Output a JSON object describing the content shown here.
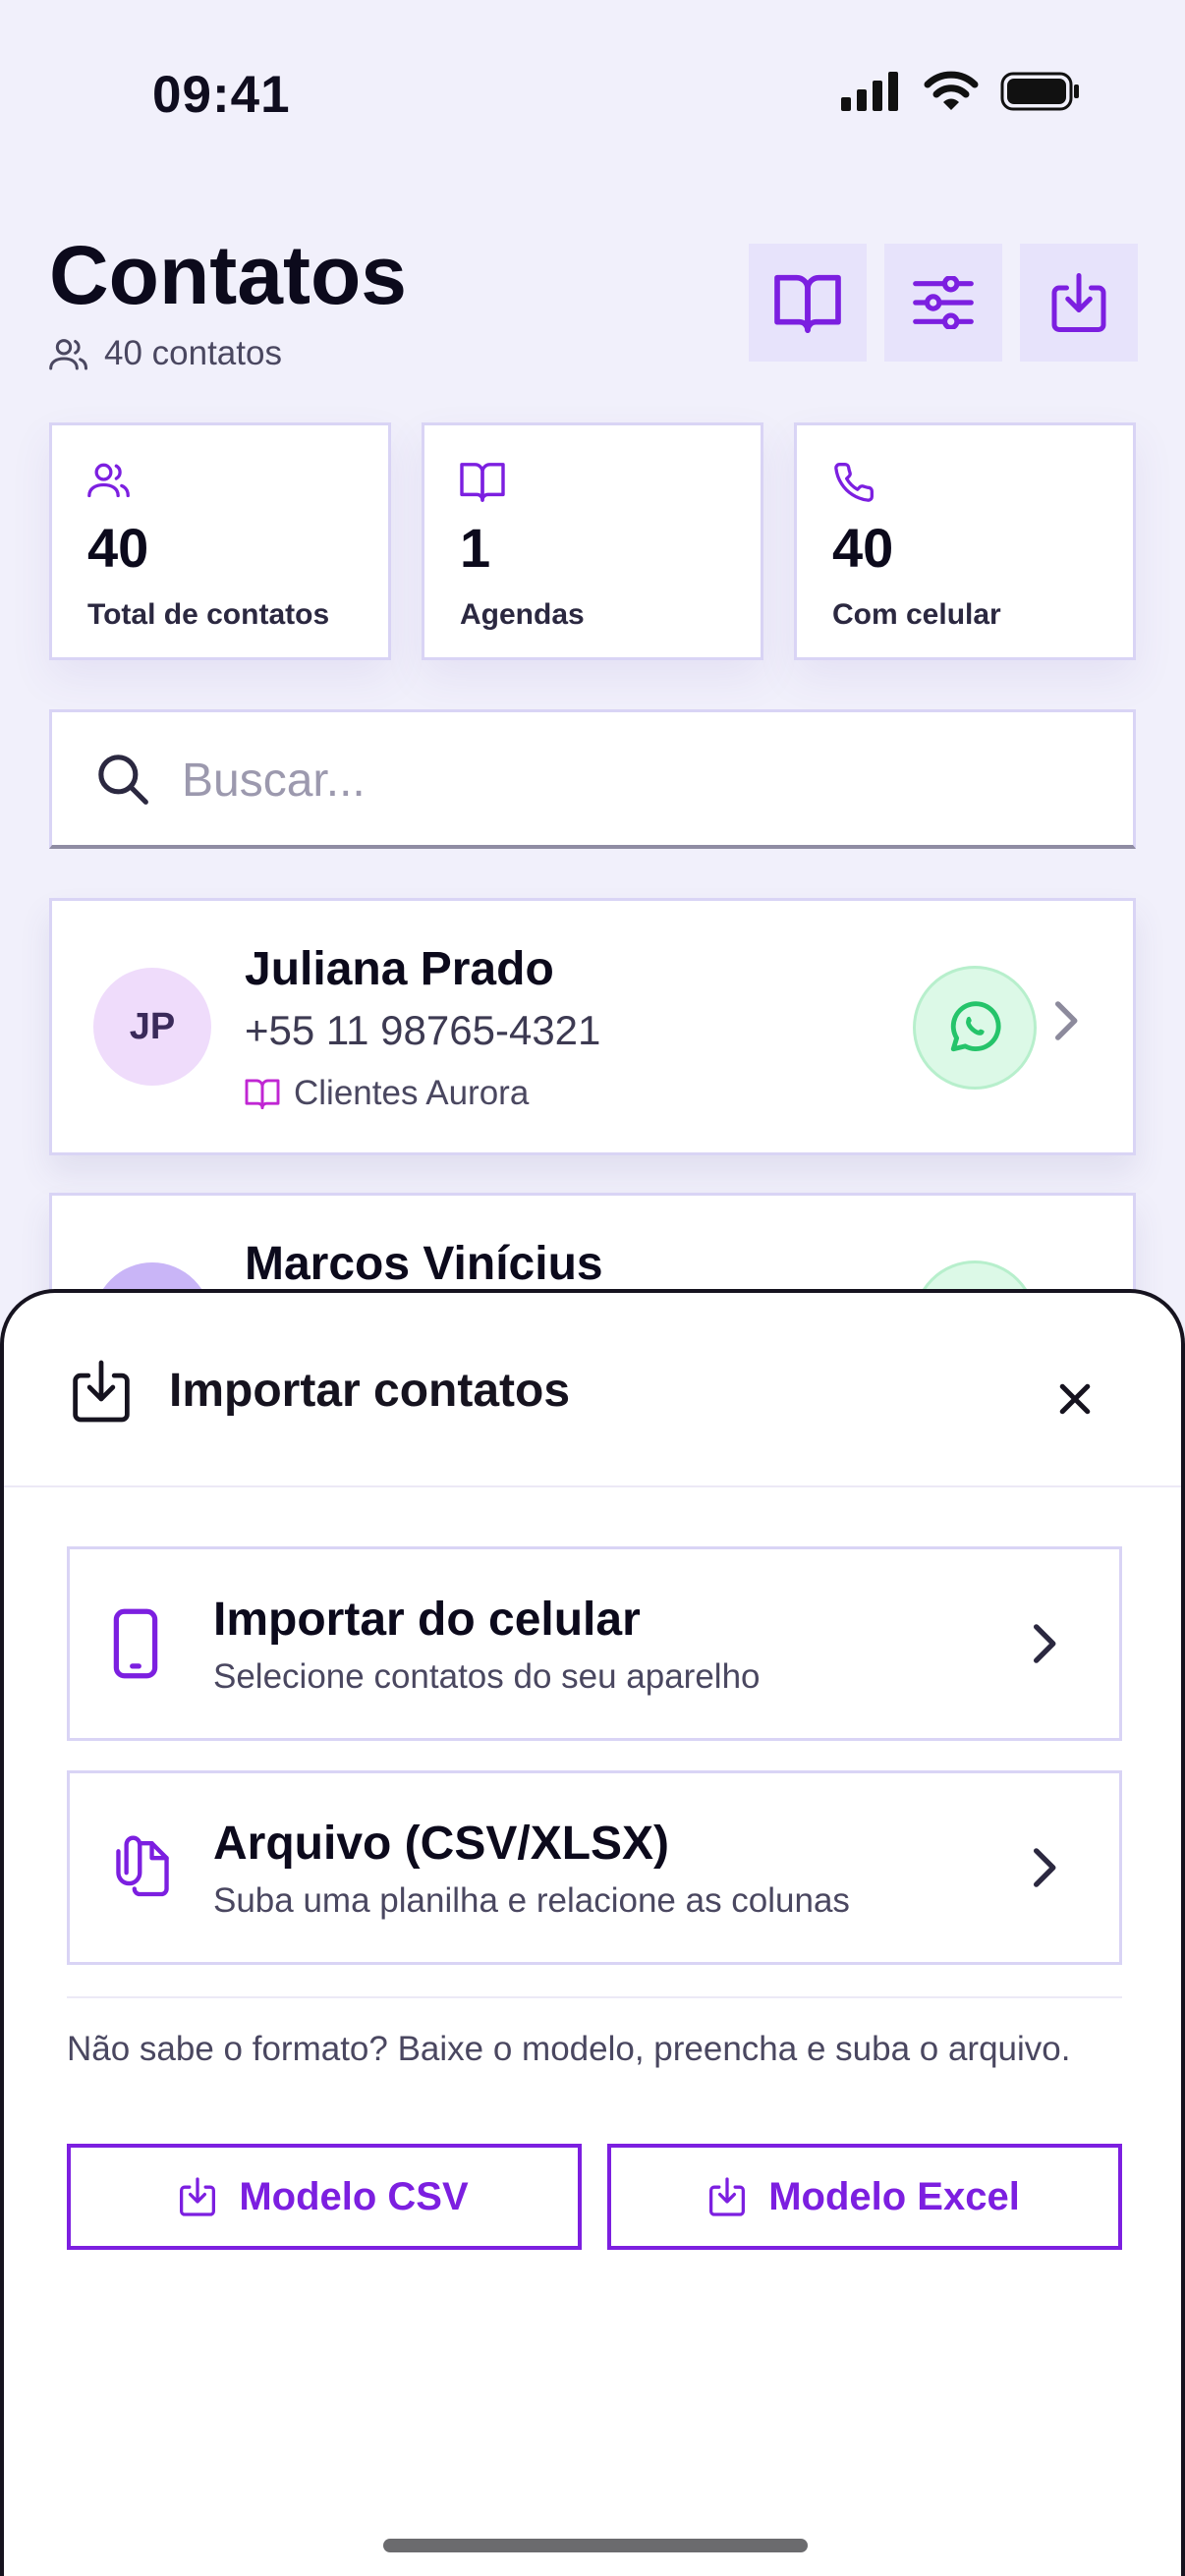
{
  "status_bar": {
    "time": "09:41"
  },
  "header": {
    "title": "Contatos",
    "count_text": "40 contatos",
    "actions": [
      {
        "icon": "book-icon",
        "name": "agendas"
      },
      {
        "icon": "sliders-icon",
        "name": "filters"
      },
      {
        "icon": "download-icon",
        "name": "import"
      }
    ]
  },
  "stats": [
    {
      "icon": "users-icon",
      "value": "40",
      "label": "Total de contatos"
    },
    {
      "icon": "book-icon",
      "value": "1",
      "label": "Agendas"
    },
    {
      "icon": "phone-icon",
      "value": "40",
      "label": "Com celular"
    }
  ],
  "search": {
    "placeholder": "Buscar..."
  },
  "contacts": [
    {
      "initials": "JP",
      "name": "Juliana Prado",
      "phone": "+55 11 98765-4321",
      "agenda": "Clientes Aurora",
      "avatar_color": "#efdcfb"
    },
    {
      "initials": "",
      "name": "Marcos Vinícius",
      "avatar_color": "#c9b5f7"
    }
  ],
  "import_sheet": {
    "title": "Importar contatos",
    "options": [
      {
        "icon": "smartphone-icon",
        "title": "Importar do celular",
        "subtitle": "Selecione contatos do seu aparelho"
      },
      {
        "icon": "file-attachment-icon",
        "title": "Arquivo (CSV/XLSX)",
        "subtitle": "Suba uma planilha e relacione as colunas"
      }
    ],
    "hint": "Não sabe o formato? Baixe o modelo, preencha e suba o arquivo.",
    "buttons": {
      "csv": "Modelo CSV",
      "excel": "Modelo Excel"
    }
  },
  "colors": {
    "accent": "#7c1fe0",
    "background": "#f1f0fb",
    "whatsapp": "#25c46a"
  }
}
